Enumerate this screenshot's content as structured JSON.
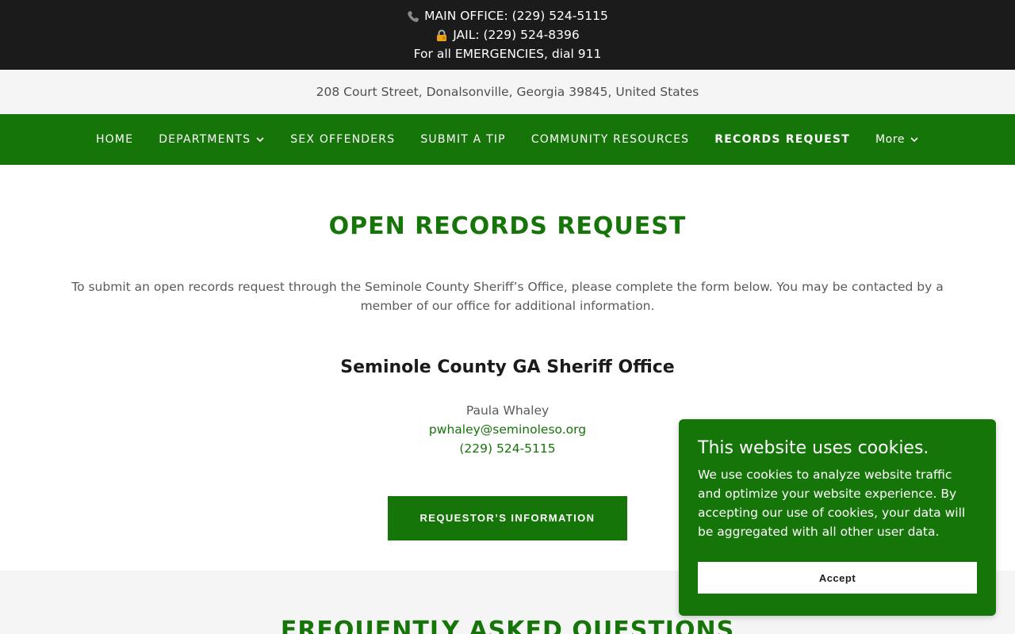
{
  "topbar": {
    "main_office": "MAIN OFFICE: (229) 524-5115",
    "jail": "JAIL: (229) 524-8396",
    "emergency": "For all EMERGENCIES, dial 911",
    "icons": [
      "phone-icon",
      "lock-icon"
    ]
  },
  "address": "208 Court Street, Donalsonville, Georgia 39845, United States",
  "nav": {
    "items": [
      {
        "label": "HOME"
      },
      {
        "label": "DEPARTMENTS"
      },
      {
        "label": "SEX OFFENDERS"
      },
      {
        "label": "SUBMIT A TIP"
      },
      {
        "label": "COMMUNITY RESOURCES"
      },
      {
        "label": "RECORDS REQUEST"
      },
      {
        "label": "More"
      }
    ],
    "active": "RECORDS REQUEST"
  },
  "main": {
    "title": "OPEN RECORDS REQUEST",
    "intro": "To submit an open records request through the Seminole County Sheriff’s Office, please complete the form below. You may be contacted by a member of our office for additional information.",
    "org": "Seminole County GA Sheriff Office",
    "contact_name": "Paula Whaley",
    "contact_email": "pwhaley@seminoleso.org",
    "contact_phone": "(229) 524-5115",
    "button": "REQUESTOR’S INFORMATION"
  },
  "faq": {
    "title": "FREQUENTLY ASKED QUESTIONS"
  },
  "cookie": {
    "title": "This website uses cookies.",
    "text": "We use cookies to analyze website traffic and optimize your website experience. By accepting our use of cookies, your data will be aggregated with all other user data.",
    "accept": "Accept"
  },
  "colors": {
    "brand_green": "#167509",
    "topbar_bg": "#1b1b1b",
    "address_bg": "#f5f5f5"
  }
}
